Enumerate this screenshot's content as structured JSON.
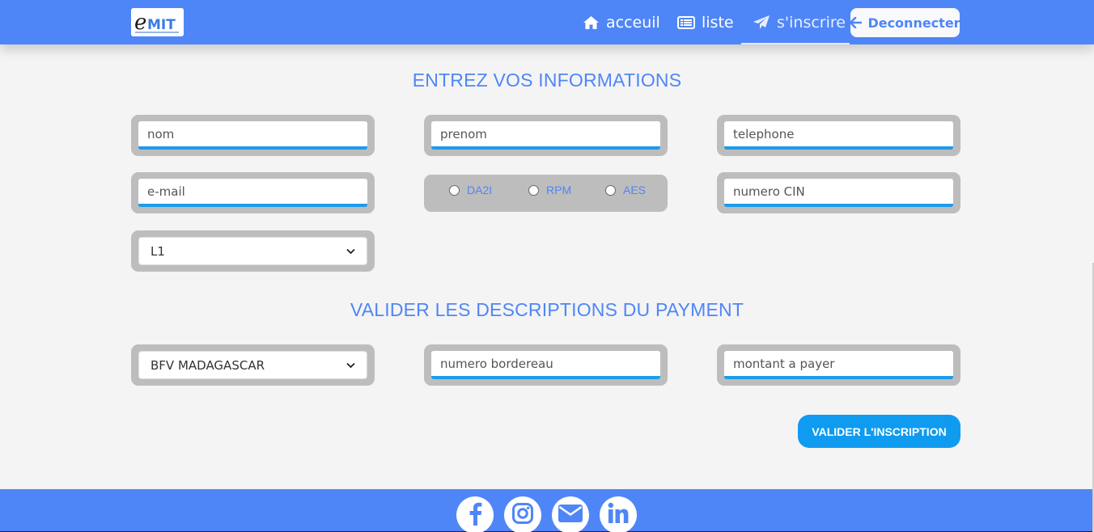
{
  "navbar": {
    "logo_text": "eMIT",
    "items": [
      {
        "label": "acceuil",
        "icon": "home-icon"
      },
      {
        "label": "liste",
        "icon": "list-icon"
      },
      {
        "label": "s'inscrire",
        "icon": "paper-plane-icon"
      }
    ],
    "logout_label": "Deconnecter",
    "logout_icon": "arrow-left-icon",
    "brand_color": "#4f86f7"
  },
  "section_info": {
    "title": "ENTREZ VOS INFORMATIONS",
    "fields": {
      "nom": "nom",
      "prenom": "prenom",
      "telephone": "telephone",
      "email": "e-mail",
      "cin": "numero CIN"
    },
    "parcours_options": [
      "DA2I",
      "RPM",
      "AES"
    ],
    "niveau_selected": "L1"
  },
  "section_payment": {
    "title": "VALIDER LES DESCRIPTIONS DU PAYMENT",
    "bank_selected": "BFV MADAGASCAR",
    "bordereau_placeholder": "numero bordereau",
    "montant_placeholder": "montant a payer"
  },
  "submit_label": "VALIDER L'INSCRIPTION",
  "footer": {
    "social": [
      "facebook-icon",
      "instagram-icon",
      "envelope-icon",
      "linkedin-icon"
    ]
  }
}
